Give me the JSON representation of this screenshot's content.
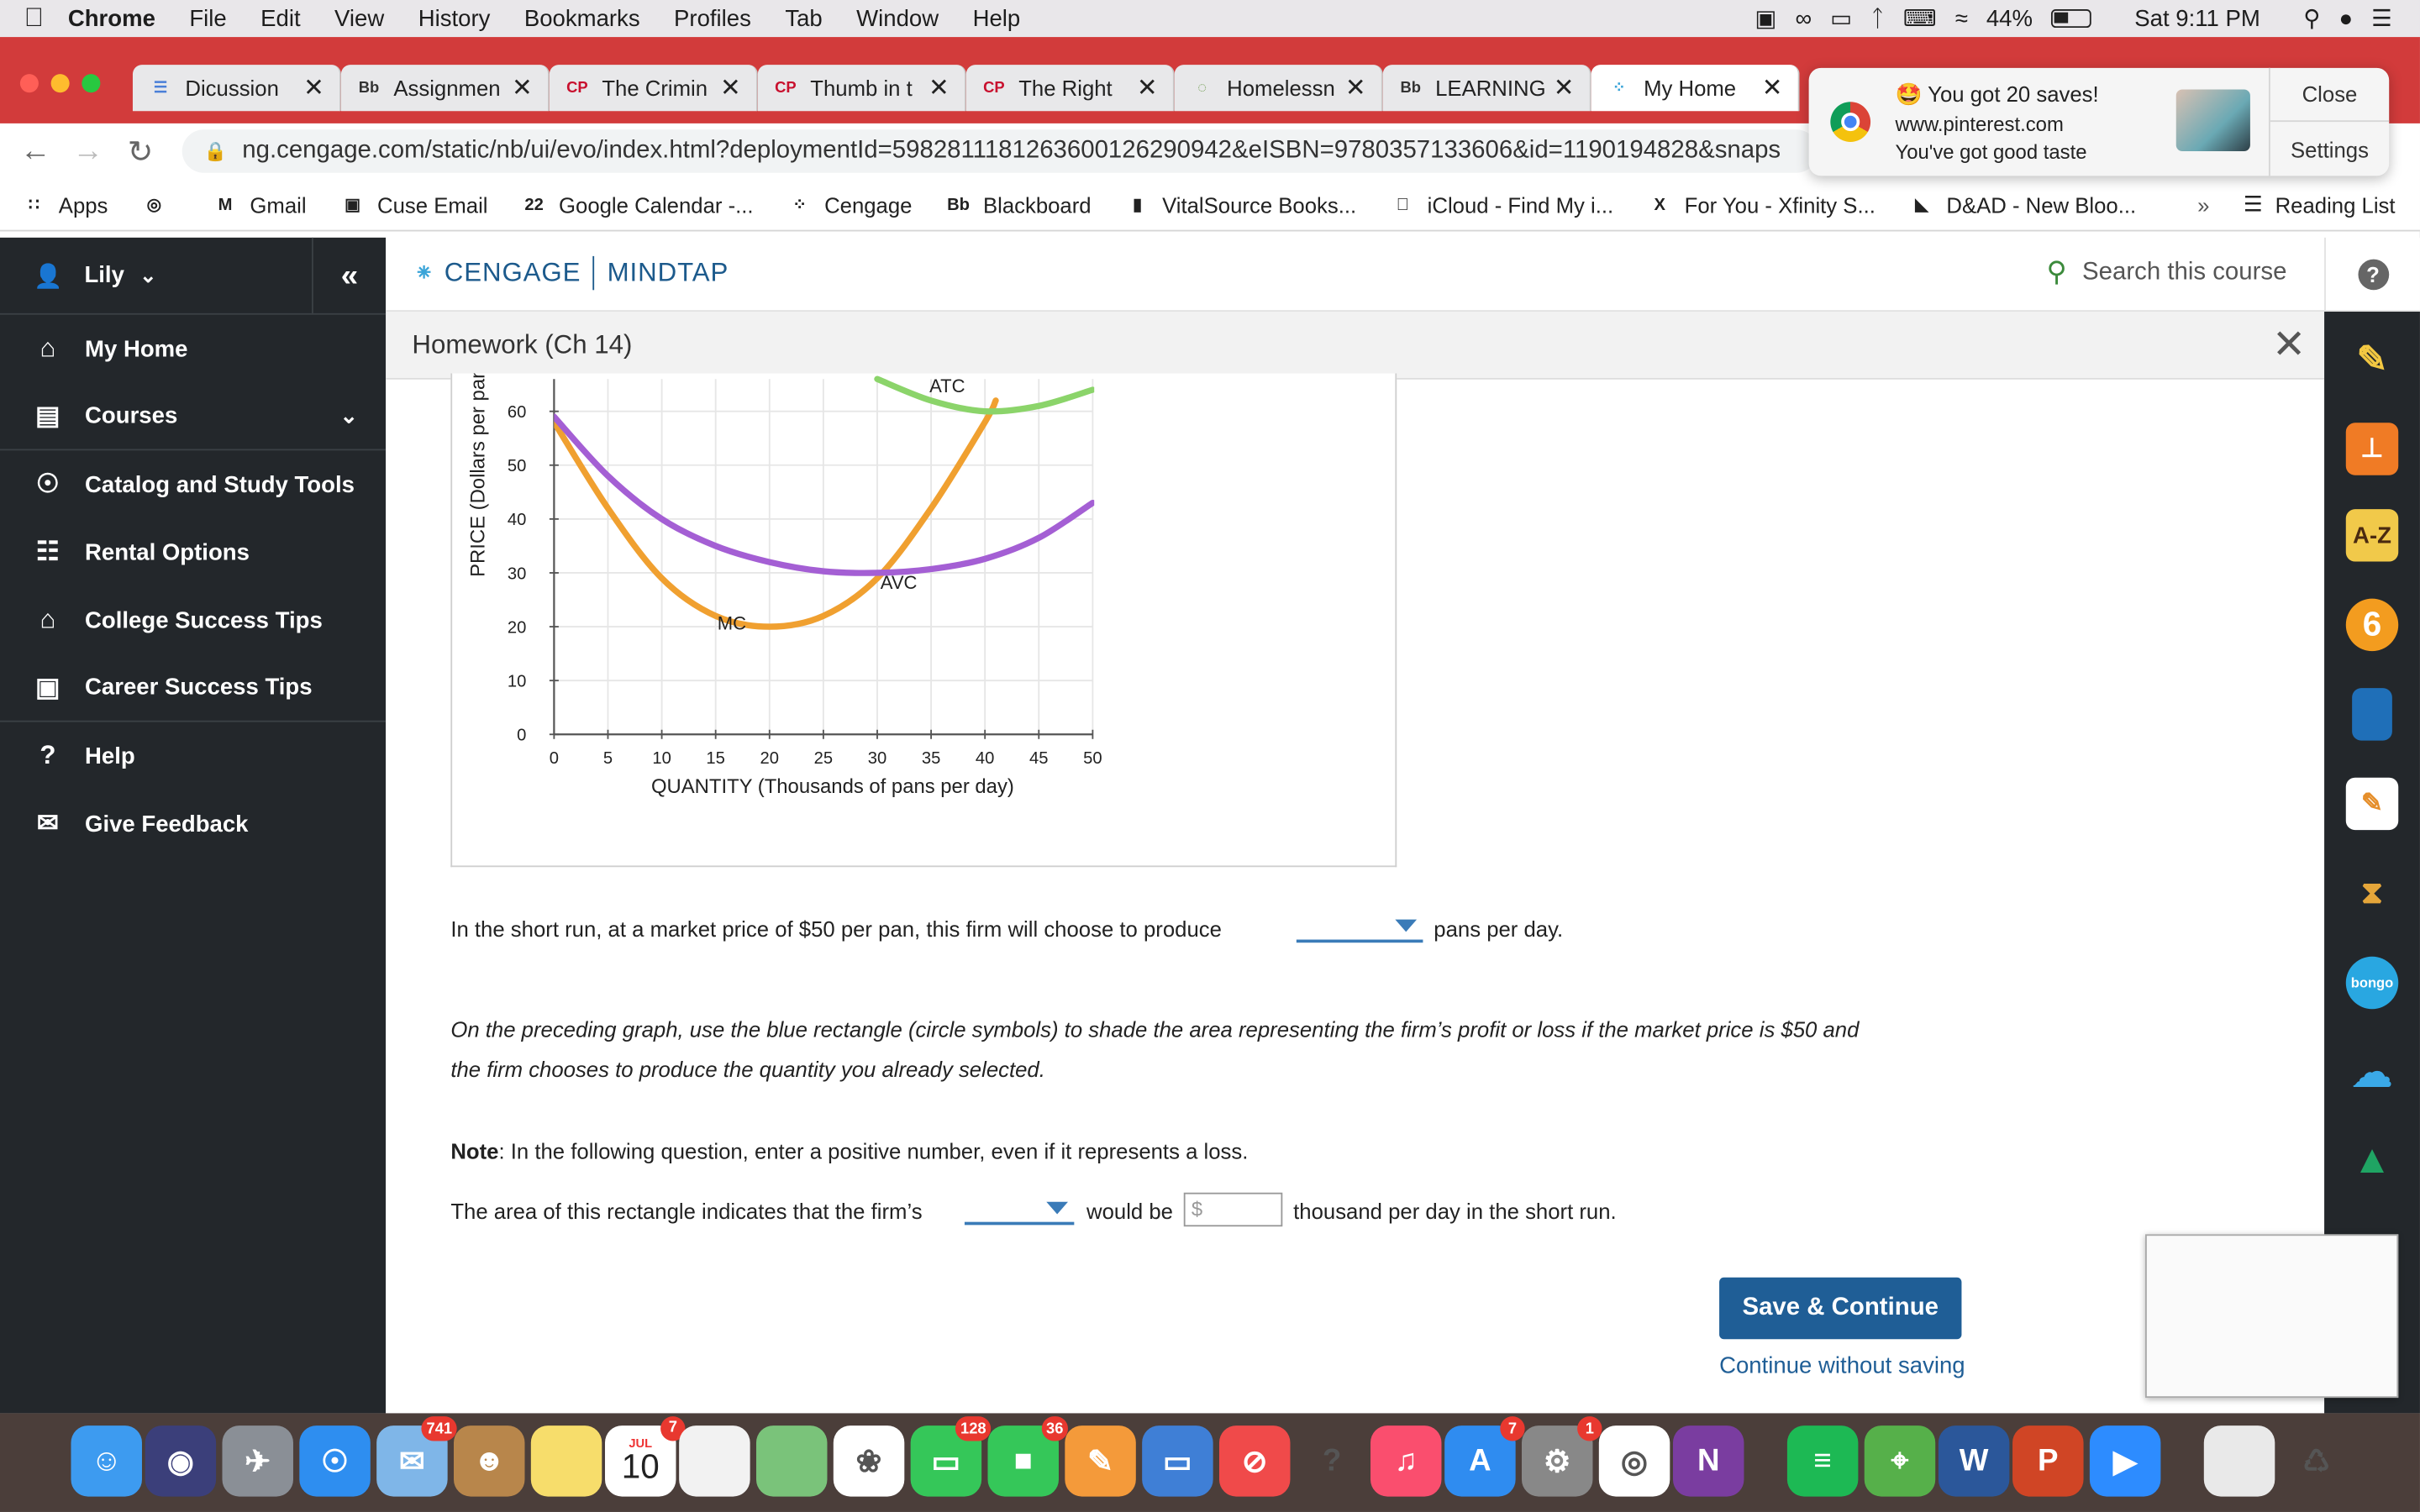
{
  "menubar": {
    "app": "Chrome",
    "items": [
      "File",
      "Edit",
      "View",
      "History",
      "Bookmarks",
      "Profiles",
      "Tab",
      "Window",
      "Help"
    ],
    "battery": "44%",
    "clock": "Sat 9:11 PM"
  },
  "tabs": [
    {
      "label": "Dicussion",
      "favicon": "docs-icon",
      "color": "#4a7fd8"
    },
    {
      "label": "Assignmen",
      "favicon": "Bb",
      "color": "#333333"
    },
    {
      "label": "The Crimin",
      "favicon": "CP",
      "color": "#c8102e"
    },
    {
      "label": "Thumb in t",
      "favicon": "CP",
      "color": "#c8102e"
    },
    {
      "label": "The Right",
      "favicon": "CP",
      "color": "#c8102e"
    },
    {
      "label": "Homelessn",
      "favicon": "circle-icon",
      "color": "#6b9a4a"
    },
    {
      "label": "LEARNING",
      "favicon": "Bb",
      "color": "#333333"
    },
    {
      "label": "My Home",
      "favicon": "cengage-icon",
      "color": "#3aa4d8",
      "active": true
    }
  ],
  "address": {
    "url": "ng.cengage.com/static/nb/ui/evo/index.html?deploymentId=5982811181263600126290942&eISBN=9780357133606&id=1190194828&snaps"
  },
  "bookmarks": [
    {
      "label": "Apps",
      "icon": "grid-icon"
    },
    {
      "label": "",
      "icon": "globe-icon"
    },
    {
      "label": "Gmail",
      "icon": "M"
    },
    {
      "label": "Cuse Email",
      "icon": "ms-icon"
    },
    {
      "label": "Google Calendar -...",
      "icon": "22"
    },
    {
      "label": "Cengage",
      "icon": "cengage-icon"
    },
    {
      "label": "Blackboard",
      "icon": "Bb"
    },
    {
      "label": "VitalSource Books...",
      "icon": "vs-icon"
    },
    {
      "label": "iCloud - Find My i...",
      "icon": "apple-icon"
    },
    {
      "label": "For You - Xfinity S...",
      "icon": "X"
    },
    {
      "label": "D&AD - New Bloo...",
      "icon": "dad-icon"
    }
  ],
  "bookmarks_more": "»",
  "reading_list": "Reading List",
  "notification": {
    "title": "You got 20 saves!",
    "site": "www.pinterest.com",
    "message": "You've got good taste",
    "close": "Close",
    "settings": "Settings"
  },
  "sidebar": {
    "user": "Lily",
    "items": [
      {
        "label": "My Home",
        "icon": "home-icon"
      },
      {
        "label": "Courses",
        "icon": "book-icon",
        "expandable": true
      },
      {
        "label": "Catalog and Study Tools",
        "icon": "compass-icon"
      },
      {
        "label": "Rental Options",
        "icon": "open-book-icon"
      },
      {
        "label": "College Success Tips",
        "icon": "graduation-cap-icon"
      },
      {
        "label": "Career Success Tips",
        "icon": "briefcase-icon"
      },
      {
        "label": "Help",
        "icon": "question-icon"
      },
      {
        "label": "Give Feedback",
        "icon": "feedback-icon"
      }
    ]
  },
  "header": {
    "brand_left": "CENGAGE",
    "brand_right": "MINDTAP",
    "search_placeholder": "Search this course"
  },
  "page": {
    "title": "Homework (Ch 14)"
  },
  "chart_data": {
    "type": "line",
    "xlabel": "QUANTITY (Thousands of pans per day)",
    "ylabel": "PRICE (Dollars per pan)",
    "xlim": [
      0,
      50
    ],
    "ylim": [
      0,
      66
    ],
    "xticks": [
      0,
      5,
      10,
      15,
      20,
      25,
      30,
      35,
      40,
      45,
      50
    ],
    "yticks": [
      0,
      10,
      20,
      30,
      40,
      50,
      60
    ],
    "grid": true,
    "series": [
      {
        "name": "MC",
        "color": "#f0a030",
        "x": [
          0,
          5,
          10,
          15,
          20,
          25,
          30,
          35,
          40,
          41
        ],
        "y": [
          58,
          42,
          29,
          22,
          20,
          22,
          29,
          42,
          58,
          62
        ]
      },
      {
        "name": "AVC",
        "color": "#a45fd4",
        "x": [
          0,
          5,
          10,
          15,
          20,
          25,
          30,
          35,
          40,
          45,
          50
        ],
        "y": [
          59,
          48,
          40,
          35,
          32,
          30.3,
          30,
          30.7,
          32.6,
          36.5,
          43
        ]
      },
      {
        "name": "ATC",
        "color": "#8bd46a",
        "x": [
          30,
          35,
          40,
          45,
          50
        ],
        "y": [
          66,
          62,
          60,
          61,
          64
        ]
      }
    ],
    "labels": [
      {
        "text": "ATC",
        "x": 36.5,
        "y": 63.5
      },
      {
        "text": "AVC",
        "x": 32,
        "y": 27
      },
      {
        "text": "MC",
        "x": 16.5,
        "y": 19.5
      }
    ]
  },
  "questions": {
    "q1_before": "In the short run, at a market price of $50 per pan, this firm will choose to produce",
    "q1_after": "pans per day.",
    "instr_line1": "On the preceding graph, use the blue rectangle (circle symbols) to shade the area representing the firm’s profit or loss if the market price is $50 and",
    "instr_line2": "the firm chooses to produce the quantity you already selected.",
    "note_bold": "Note",
    "note_text": ": In the following question, enter a positive number, even if it represents a loss.",
    "q2_before": "The area of this rectangle indicates that the firm’s",
    "q2_middle": "would be",
    "q2_input_placeholder": "$",
    "q2_after": "thousand per day in the short run."
  },
  "actions": {
    "save": "Save & Continue",
    "continue": "Continue without saving"
  },
  "dock_badges": {
    "mail": "741",
    "calendar": "7",
    "calendar_date": "10",
    "calendar_month": "JUL",
    "messages": "128",
    "facetime": "36",
    "appstore": "7",
    "prefs": "1"
  }
}
